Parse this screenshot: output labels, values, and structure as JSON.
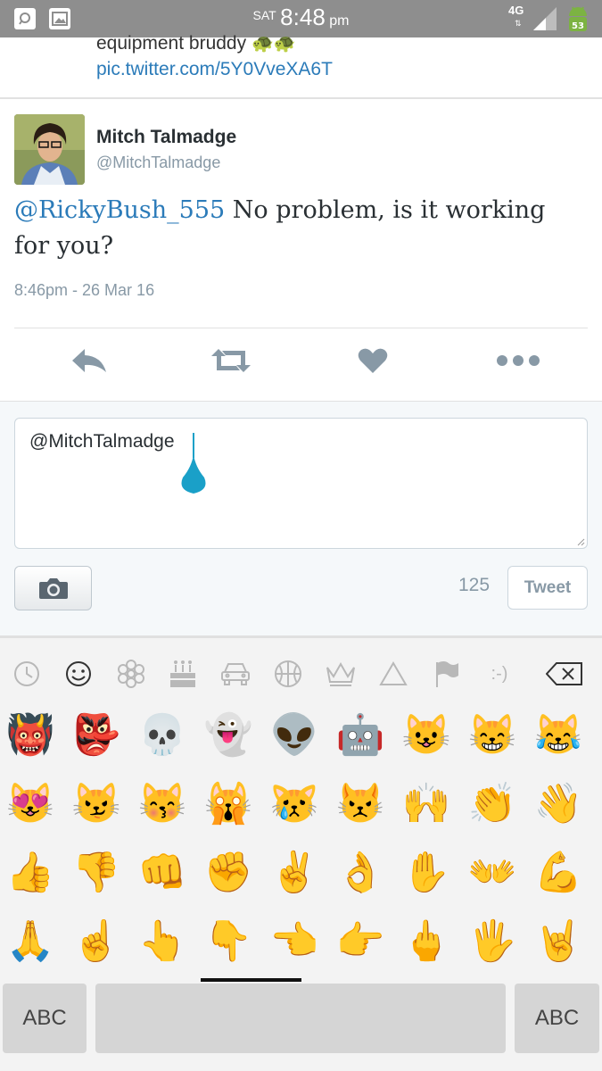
{
  "status_bar": {
    "day": "SAT",
    "time": "8:48",
    "ampm": "pm",
    "network": "4G",
    "battery": "53"
  },
  "previous_tweet": {
    "text": "equipment bruddy",
    "link": "pic.twitter.com/5Y0VveXA6T"
  },
  "tweet": {
    "author_name": "Mitch Talmadge",
    "author_handle": "@MitchTalmadge",
    "mention": "@RickyBush_555",
    "text": " No problem, is it working for you?",
    "timestamp": "8:46pm - 26 Mar 16"
  },
  "actions": {
    "reply_icon": "reply-icon",
    "retweet_icon": "retweet-icon",
    "like_icon": "heart-icon",
    "more_icon": "more-icon"
  },
  "compose": {
    "value": "@MitchTalmadge",
    "char_count": "125",
    "tweet_label": "Tweet"
  },
  "keyboard": {
    "categories": [
      "recent-icon",
      "smiley-icon",
      "flower-icon",
      "cake-icon",
      "car-icon",
      "basketball-icon",
      "crown-icon",
      "triangle-icon",
      "flag-icon",
      ":-)",
      "backspace-icon"
    ],
    "emoticon_label": ":-)",
    "emoji_rows": [
      [
        "👹",
        "👺",
        "💀",
        "👻",
        "👽",
        "🤖",
        "😺",
        "😸",
        "😹"
      ],
      [
        "😻",
        "😼",
        "😽",
        "🙀",
        "😿",
        "😾",
        "🙌",
        "👏",
        "👋"
      ],
      [
        "👍",
        "👎",
        "👊",
        "✊",
        "✌",
        "👌",
        "✋",
        "👐",
        "💪"
      ],
      [
        "🙏",
        "☝",
        "👆",
        "👇",
        "👈",
        "👉",
        "🖕",
        "🖐",
        "🤘"
      ]
    ],
    "left_key": "ABC",
    "right_key": "ABC"
  },
  "colors": {
    "status_bar": "#8e8e8e",
    "link": "#2b7bb9",
    "muted": "#8899a6",
    "cursor": "#1aa0c8"
  }
}
